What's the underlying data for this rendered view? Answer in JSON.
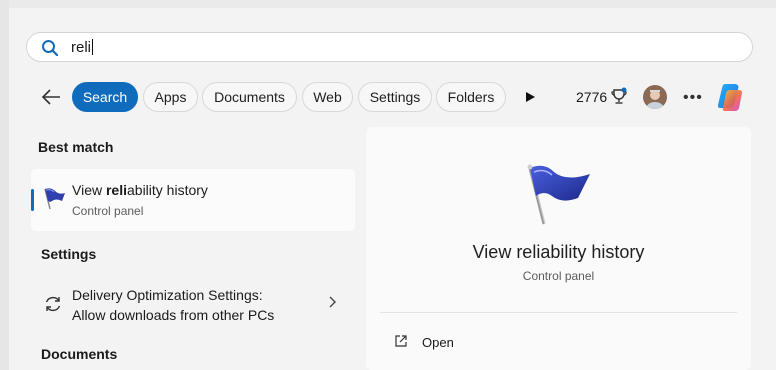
{
  "search": {
    "query": "reli"
  },
  "filters": [
    "Search",
    "Apps",
    "Documents",
    "Web",
    "Settings",
    "Folders"
  ],
  "rewards": {
    "points": "2776"
  },
  "sections": {
    "best_match": "Best match",
    "settings": "Settings",
    "documents": "Documents"
  },
  "best_match": {
    "title_prefix": "View ",
    "title_bold": "reli",
    "title_suffix": "ability history",
    "subtitle": "Control panel"
  },
  "settings_result": {
    "line1": "Delivery Optimization Settings:",
    "line2": "Allow downloads from other PCs"
  },
  "preview": {
    "title": "View reliability history",
    "subtitle": "Control panel",
    "actions": [
      "Open"
    ]
  },
  "colors": {
    "accent": "#0f6cbd",
    "flag": "#2f3fae"
  }
}
